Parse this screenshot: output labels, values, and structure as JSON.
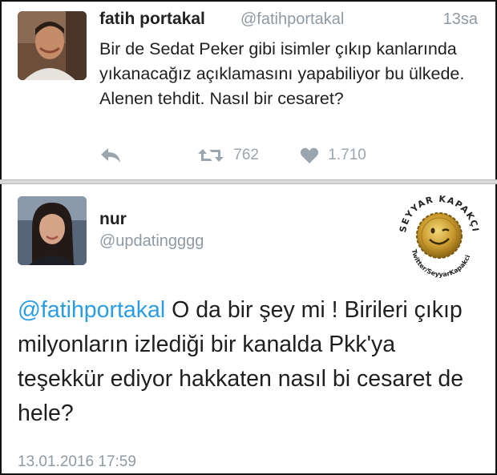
{
  "tweet1": {
    "name": "fatih portakal",
    "handle": "@fatihportakal",
    "time": "13sa",
    "text": "Bir de Sedat Peker gibi isimler çıkıp kanlarında yıkanacağız açıklamasını yapabiliyor bu ülkede. Alenen tehdit. Nasıl bir cesaret?",
    "retweets": "762",
    "likes": "1.710"
  },
  "tweet2": {
    "name": "nur",
    "handle": "@updatingggg",
    "mention": "@fatihportakal",
    "text": " O da bir şey mi ! Birileri çıkıp milyonların izlediği bir kanalda Pkk'ya teşekkür ediyor hakkaten nasıl bi cesaret de hele?",
    "date": "13.01.2016 17:59"
  },
  "watermark": {
    "top_text": "SEYYAR KAPAKÇI",
    "bottom_text": "Twitter/SeyyarKapakci"
  },
  "colors": {
    "mention": "#2b9de2",
    "meta": "#8f9aa3",
    "icon": "#9aa5ae"
  },
  "icons": [
    "reply-icon",
    "retweet-icon",
    "heart-icon"
  ]
}
